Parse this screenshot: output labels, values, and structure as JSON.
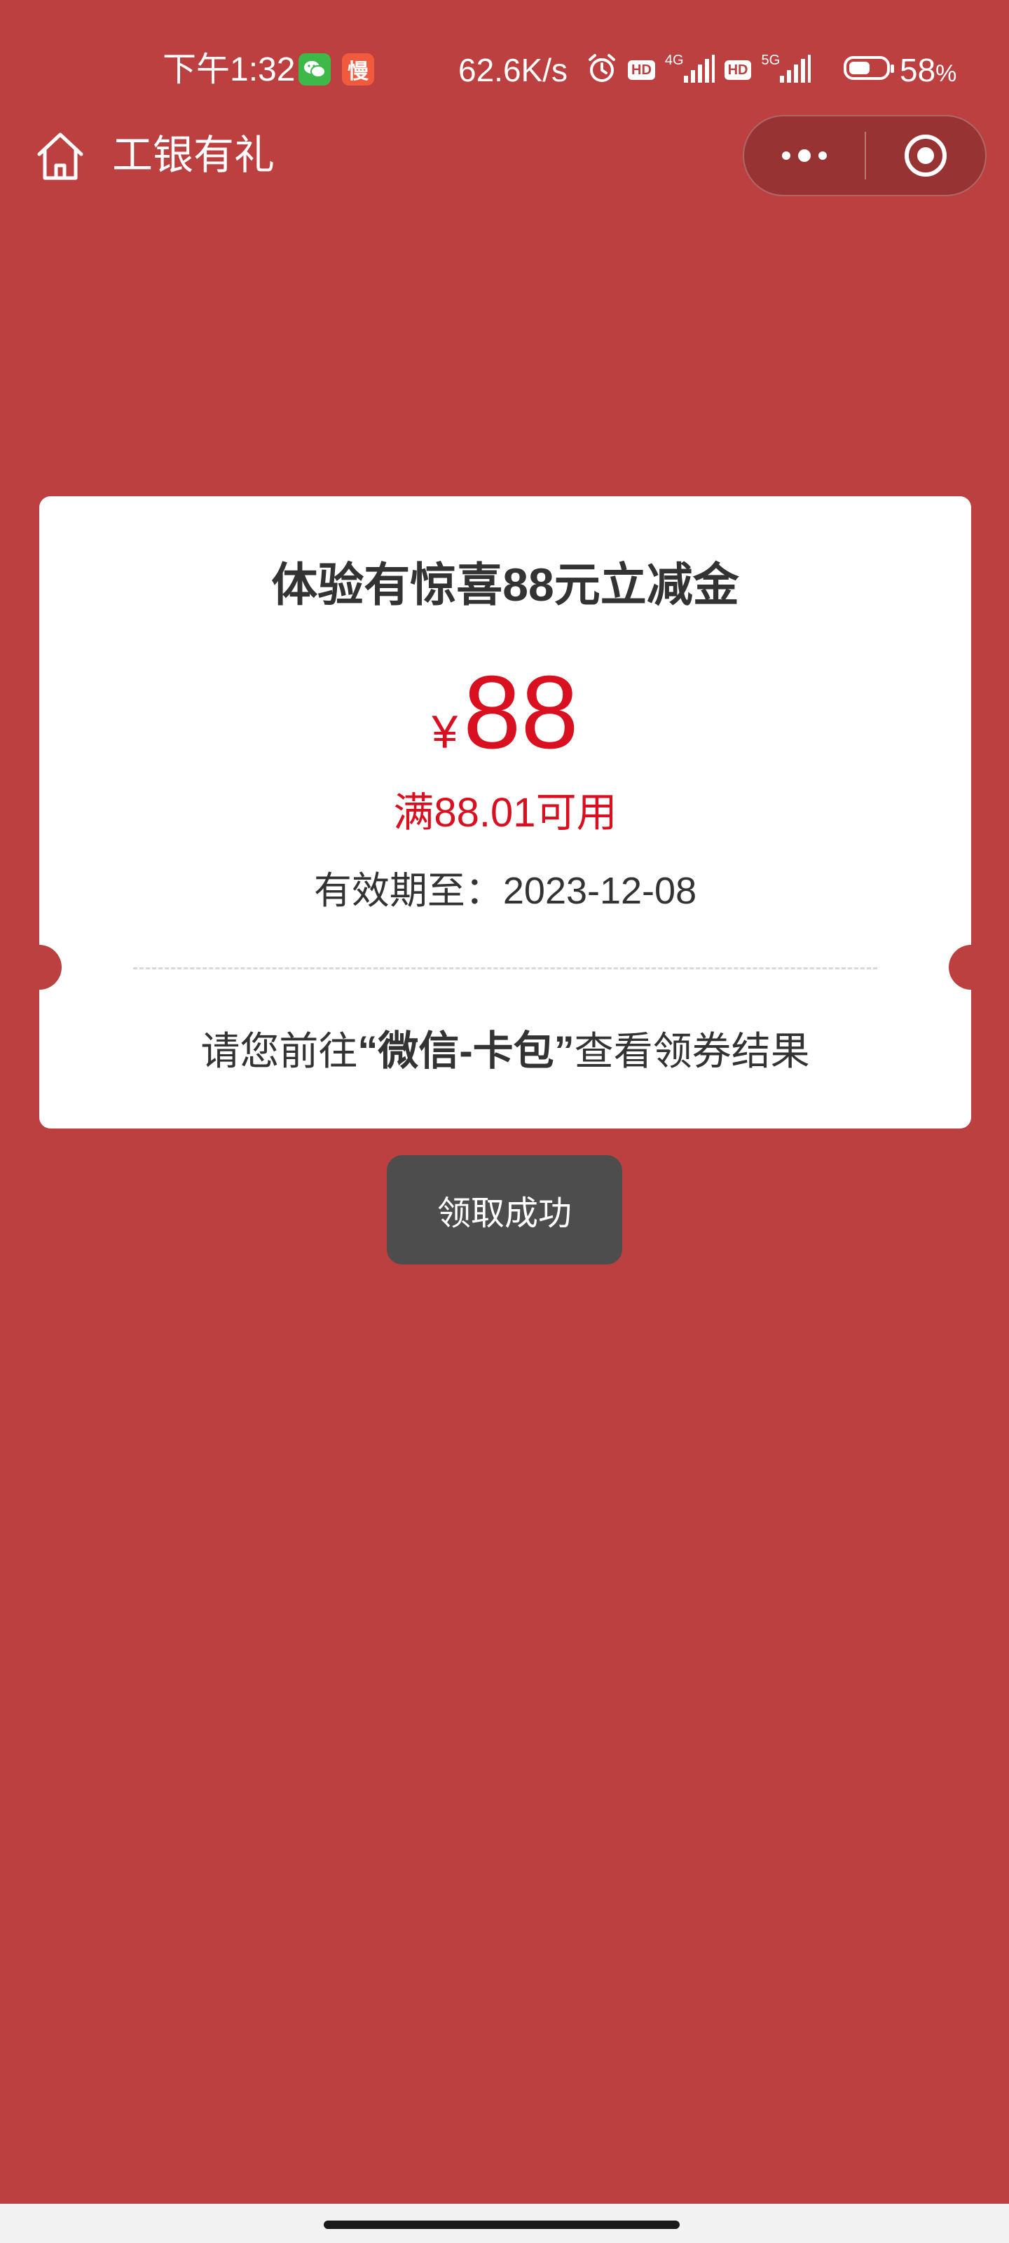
{
  "status_bar": {
    "time": "下午1:32",
    "slow_badge": "慢",
    "net_speed": "62.6K/s",
    "hd_badge": "HD",
    "network_4g": "4G",
    "network_5g": "5G",
    "battery_value": "58",
    "battery_unit": "%",
    "battery_level": 0.58,
    "icons": [
      "wechat-icon",
      "slow-app-icon",
      "alarm-icon",
      "signal-icon",
      "battery-icon"
    ]
  },
  "nav": {
    "title": "工银有礼",
    "home_icon": "home-icon",
    "menu_icon": "more-dots-icon",
    "close_icon": "target-close-icon"
  },
  "coupon": {
    "title": "体验有惊喜88元立减金",
    "currency_symbol": "¥",
    "amount": "88",
    "condition": "满88.01可用",
    "validity": "有效期至：2023-12-08",
    "tip_prefix": "请您前往",
    "tip_emphasis": "“微信-卡包”",
    "tip_suffix": "查看领券结果"
  },
  "toast": {
    "message": "领取成功"
  },
  "colors": {
    "background": "#BC4040",
    "accent_red": "#D9101F",
    "toast_bg": "#4D4D4D",
    "card_bg": "#FFFFFF"
  }
}
